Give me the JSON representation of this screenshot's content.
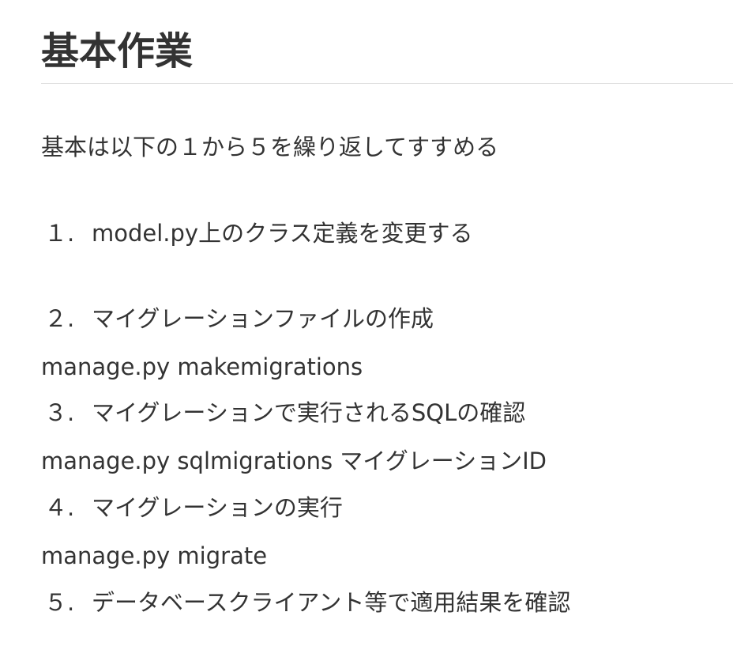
{
  "heading": "基本作業",
  "intro": "基本は以下の１から５を繰り返してすすめる",
  "steps": [
    {
      "num": "１.",
      "text": "model.py上のクラス定義を変更する"
    },
    {
      "num": "２.",
      "text": "マイグレーションファイルの作成"
    },
    {
      "num": "３.",
      "text": "マイグレーションで実行されるSQLの確認"
    },
    {
      "num": "４.",
      "text": "マイグレーションの実行"
    },
    {
      "num": "５.",
      "text": "データベースクライアント等で適用結果を確認"
    }
  ],
  "commands": [
    "manage.py makemigrations",
    "manage.py sqlmigrations マイグレーションID",
    "manage.py migrate"
  ]
}
